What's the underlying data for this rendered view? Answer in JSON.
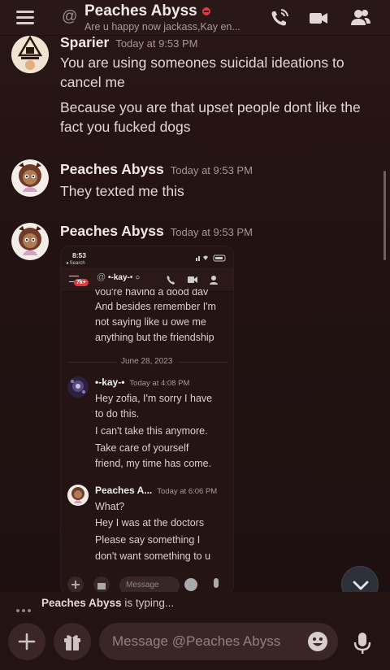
{
  "header": {
    "channel_name": "Peaches Abyss",
    "status_text": "Are u happy now jackass,Kay en...",
    "icons": [
      "menu-icon",
      "at-icon",
      "voice-call-icon",
      "video-call-icon",
      "members-icon"
    ]
  },
  "messages": [
    {
      "author": "Sparier",
      "timestamp": "Today at 9:53 PM",
      "lines": [
        "You are using someones suicidal ideations to",
        "cancel me",
        "Because you are that upset people dont like the",
        "fact you fucked dogs"
      ]
    },
    {
      "author": "Peaches Abyss",
      "timestamp": "Today at 9:53 PM",
      "lines": [
        "They texted me this"
      ]
    },
    {
      "author": "Peaches Abyss",
      "timestamp": "Today at 9:53 PM",
      "attachment": "screenshot"
    }
  ],
  "embedded_screenshot": {
    "status_time": "8:53",
    "back_label": "◂ Search",
    "badge": "7k+",
    "dm_name": "•-kay-• ○",
    "cut_line": "you're having a good day",
    "lines_top": [
      "And besides remember I'm",
      "not saying like u owe me",
      "anything but the friendship"
    ],
    "date_divider": "June 28, 2023",
    "msg1": {
      "author": "•-kay-•",
      "timestamp": "Today at 4:08 PM",
      "lines": [
        "Hey zofia, I'm sorry I have",
        "to do this.",
        "I can't take this anymore.",
        "Take care of yourself",
        "friend, my time has come."
      ]
    },
    "msg2": {
      "author": "Peaches A...",
      "timestamp": "Today at 6:06 PM",
      "lines": [
        "What?",
        "Hey I was at the doctors",
        "Please say something I",
        "don't want something to u"
      ]
    },
    "composer_placeholder": "Message"
  },
  "typing": {
    "user": "Peaches Abyss",
    "suffix": "is typing..."
  },
  "composer": {
    "placeholder": "Message @Peaches Abyss"
  },
  "colors": {
    "background": "#221212",
    "dnd_status": "#e0393f",
    "text": "#e3d6d6",
    "muted": "#a69898"
  }
}
